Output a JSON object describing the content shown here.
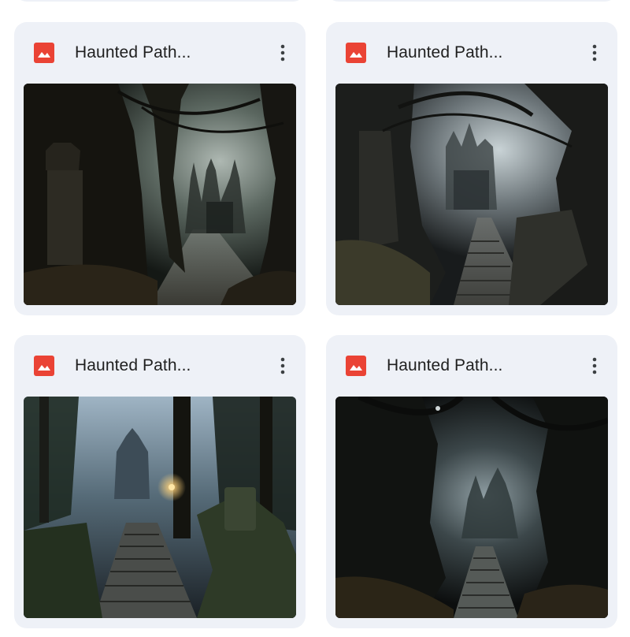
{
  "colors": {
    "card_bg": "#eef1f7",
    "image_icon": "#ea4335",
    "title_text": "#1f1f1f",
    "more_icon": "#3c4043"
  },
  "cards": [
    {
      "title": "Haunted Path...",
      "icon": "image-file-icon",
      "menu_icon": "more-vert-icon"
    },
    {
      "title": "Haunted Path...",
      "icon": "image-file-icon",
      "menu_icon": "more-vert-icon"
    },
    {
      "title": "Haunted Path...",
      "icon": "image-file-icon",
      "menu_icon": "more-vert-icon"
    },
    {
      "title": "Haunted Path...",
      "icon": "image-file-icon",
      "menu_icon": "more-vert-icon"
    }
  ]
}
